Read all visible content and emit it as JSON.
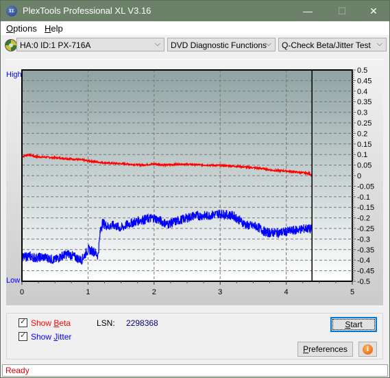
{
  "window": {
    "title": "PlexTools Professional XL V3.16",
    "app_icon": "xl-logo-icon",
    "app_icon_text": "XL",
    "controls": {
      "minimize": "—",
      "maximize": "☐",
      "close": "✕"
    }
  },
  "menu": [
    {
      "label": "Options",
      "accel": "O"
    },
    {
      "label": "Help",
      "accel": "H"
    }
  ],
  "toolbar": {
    "drive_icon": "disc-icon",
    "drive_select": "HA:0 ID:1  PX-716A",
    "function_select": "DVD Diagnostic Functions",
    "test_select": "Q-Check Beta/Jitter Test"
  },
  "chart_data": {
    "type": "line",
    "title": "",
    "xlabel": "",
    "ylabel": "",
    "left_axis_labels": {
      "high": "High",
      "low": "Low"
    },
    "xlim": [
      0,
      5
    ],
    "ylim": [
      -0.5,
      0.5
    ],
    "x_ticks": [
      "0",
      "1",
      "2",
      "3",
      "4",
      "5"
    ],
    "y_ticks": [
      "0.5",
      "0.45",
      "0.4",
      "0.35",
      "0.3",
      "0.25",
      "0.2",
      "0.15",
      "0.1",
      "0.05",
      "0",
      "-0.05",
      "-0.1",
      "-0.15",
      "-0.2",
      "-0.25",
      "-0.3",
      "-0.35",
      "-0.4",
      "-0.45",
      "-0.5"
    ],
    "grid": true,
    "end_marker_x": 4.39,
    "series": [
      {
        "name": "Beta",
        "color": "#ff0000",
        "x": [
          0,
          0.1,
          0.2,
          0.3,
          0.5,
          0.7,
          0.9,
          1.0,
          1.2,
          1.4,
          1.6,
          1.8,
          2.0,
          2.2,
          2.4,
          2.6,
          2.8,
          3.0,
          3.2,
          3.4,
          3.6,
          3.8,
          4.0,
          4.2,
          4.35,
          4.39
        ],
        "values": [
          0.09,
          0.1,
          0.09,
          0.088,
          0.085,
          0.08,
          0.075,
          0.07,
          0.062,
          0.058,
          0.055,
          0.05,
          0.055,
          0.05,
          0.055,
          0.052,
          0.05,
          0.048,
          0.045,
          0.04,
          0.035,
          0.025,
          0.022,
          0.015,
          0.01,
          0.0
        ]
      },
      {
        "name": "Jitter",
        "color": "#0000ff",
        "x": [
          0,
          0.1,
          0.2,
          0.3,
          0.4,
          0.5,
          0.6,
          0.7,
          0.8,
          0.9,
          1.0,
          1.1,
          1.15,
          1.2,
          1.3,
          1.4,
          1.5,
          1.6,
          1.8,
          2.0,
          2.2,
          2.4,
          2.6,
          2.8,
          3.0,
          3.2,
          3.4,
          3.55,
          3.7,
          3.9,
          4.1,
          4.3,
          4.39
        ],
        "values": [
          -0.39,
          -0.38,
          -0.39,
          -0.385,
          -0.39,
          -0.4,
          -0.38,
          -0.37,
          -0.385,
          -0.4,
          -0.35,
          -0.36,
          -0.38,
          -0.22,
          -0.24,
          -0.235,
          -0.25,
          -0.23,
          -0.21,
          -0.2,
          -0.23,
          -0.21,
          -0.19,
          -0.19,
          -0.18,
          -0.19,
          -0.235,
          -0.24,
          -0.27,
          -0.27,
          -0.26,
          -0.25,
          -0.255
        ]
      }
    ]
  },
  "controls": {
    "show_beta": {
      "label_pre": "Show ",
      "accel": "B",
      "label_post": "eta",
      "checked": true,
      "color": "#ff0000"
    },
    "show_jitter": {
      "label_pre": "Show ",
      "accel": "J",
      "label_post": "itter",
      "checked": true,
      "color": "#0000ff"
    },
    "lsn_label": "LSN:",
    "lsn_value": "2298368",
    "start_button": {
      "accel": "S",
      "rest": "tart"
    },
    "preferences_button": {
      "accel": "P",
      "rest": "references"
    },
    "info_icon": "info-icon"
  },
  "status": {
    "text": "Ready"
  }
}
